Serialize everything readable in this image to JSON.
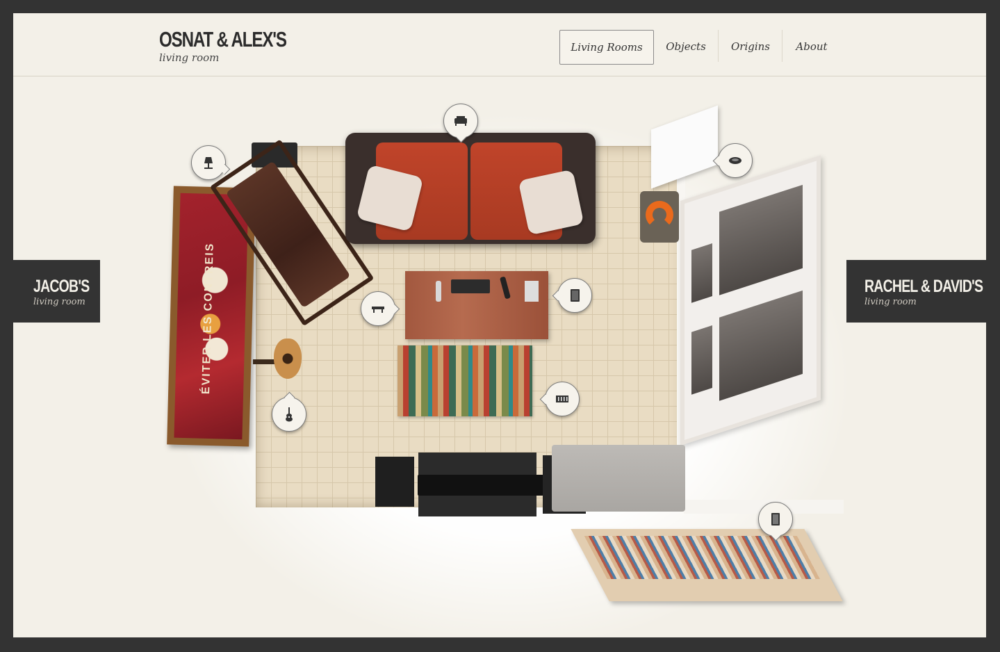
{
  "header": {
    "title": "OSNAT & ALEX'S",
    "subtitle": "living room"
  },
  "nav": {
    "items": [
      {
        "label": "Living Rooms",
        "active": true
      },
      {
        "label": "Objects",
        "active": false
      },
      {
        "label": "Origins",
        "active": false
      },
      {
        "label": "About",
        "active": false
      }
    ]
  },
  "prev_room": {
    "name": "JACOB'S",
    "sub": "living room"
  },
  "next_room": {
    "name": "RACHEL & DAVID'S",
    "sub": "living room"
  },
  "poster": {
    "text": "ÉVITER LES CONTREIS"
  },
  "hotspots": [
    {
      "icon": "sofa-icon"
    },
    {
      "icon": "lamp-icon"
    },
    {
      "icon": "speaker-icon"
    },
    {
      "icon": "bench-icon"
    },
    {
      "icon": "book-icon"
    },
    {
      "icon": "rug-icon"
    },
    {
      "icon": "guitar-icon"
    },
    {
      "icon": "tablet-icon"
    }
  ],
  "colors": {
    "frame": "#333333",
    "background": "#f3f0e8",
    "sofa": "#b03e25"
  }
}
